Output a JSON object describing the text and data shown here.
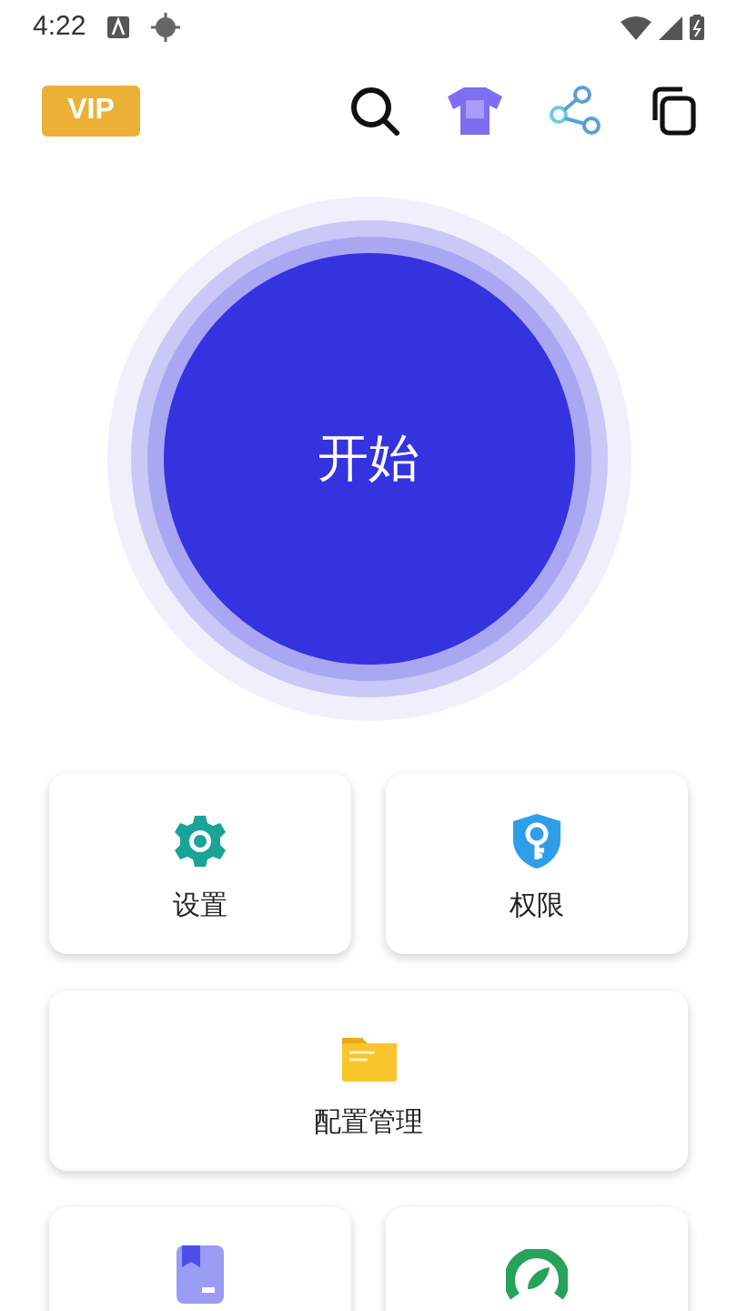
{
  "status_bar": {
    "time": "4:22"
  },
  "header": {
    "vip_badge": "VIP"
  },
  "start_button": {
    "label": "开始"
  },
  "cards": [
    {
      "kind": "half",
      "label": "设置"
    },
    {
      "kind": "half",
      "label": "权限"
    },
    {
      "kind": "wide",
      "label": "配置管理"
    },
    {
      "kind": "half"
    },
    {
      "kind": "half"
    }
  ]
}
